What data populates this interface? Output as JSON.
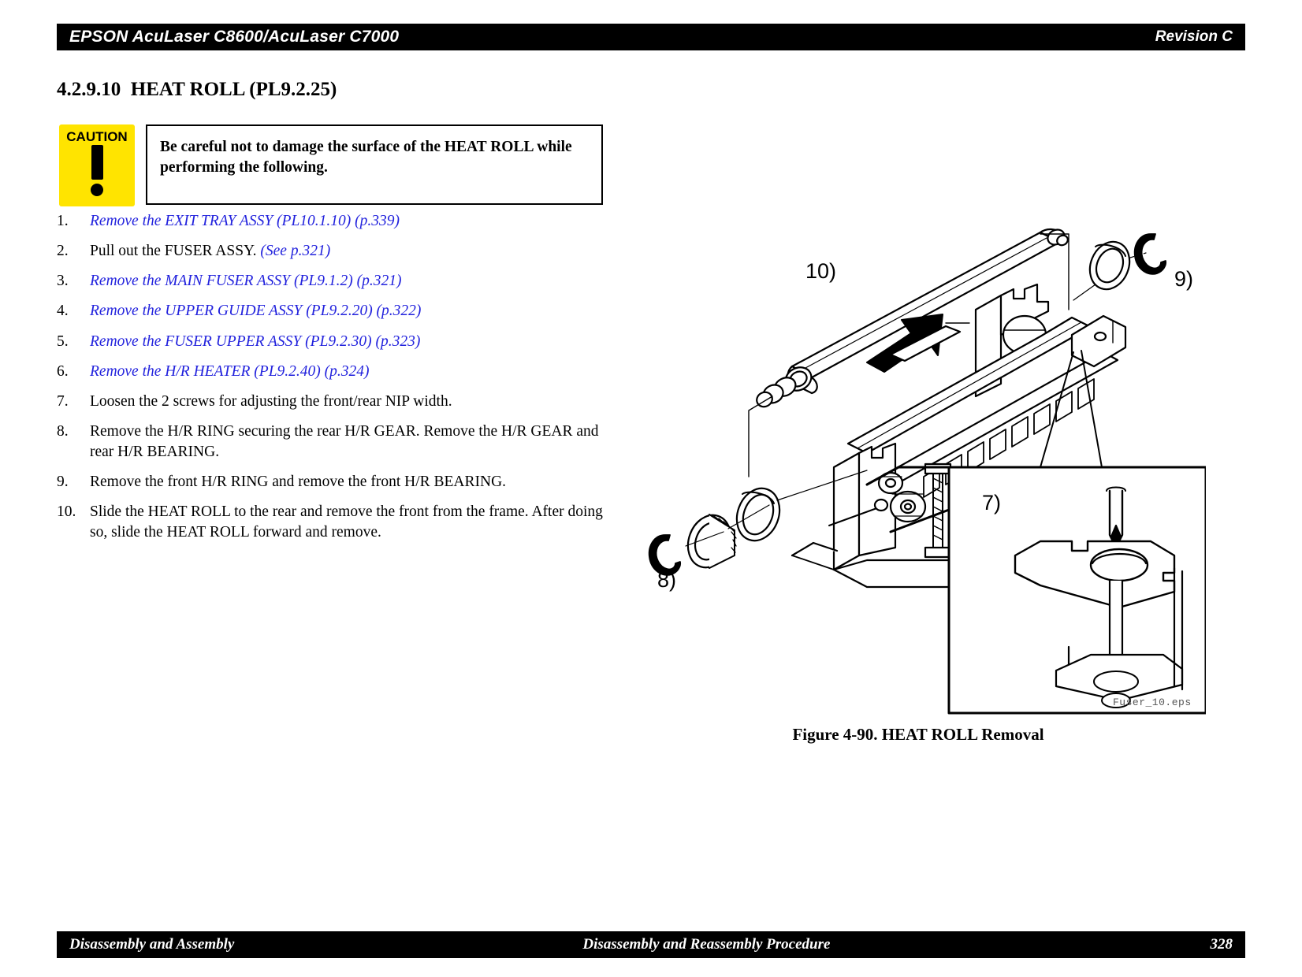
{
  "header": {
    "title": "EPSON AcuLaser C8600/AcuLaser C7000",
    "revision": "Revision C"
  },
  "section": {
    "heading": "4.2.9.10  HEAT ROLL (PL9.2.25)"
  },
  "caution": {
    "badge_label": "CAUTION",
    "text": "Be careful not to damage the surface of the HEAT ROLL while performing the following."
  },
  "steps": [
    {
      "num": "1.",
      "link": "Remove the EXIT TRAY ASSY (PL10.1.10) (p.339)",
      "plain_before": "",
      "plain_after": ""
    },
    {
      "num": "2.",
      "plain_before": "Pull out the FUSER ASSY. ",
      "link": "(See p.321)",
      "plain_after": ""
    },
    {
      "num": "3.",
      "link": "Remove the MAIN FUSER ASSY (PL9.1.2) (p.321)",
      "plain_before": "",
      "plain_after": ""
    },
    {
      "num": "4.",
      "link": "Remove the UPPER GUIDE ASSY (PL9.2.20) (p.322)",
      "plain_before": "",
      "plain_after": ""
    },
    {
      "num": "5.",
      "link": "Remove the FUSER UPPER ASSY (PL9.2.30) (p.323)",
      "plain_before": "",
      "plain_after": ""
    },
    {
      "num": "6.",
      "link": "Remove the H/R HEATER (PL9.2.40) (p.324)",
      "plain_before": "",
      "plain_after": ""
    },
    {
      "num": "7.",
      "plain_before": "Loosen the 2 screws for adjusting the front/rear NIP width.",
      "link": "",
      "plain_after": ""
    },
    {
      "num": "8.",
      "plain_before": "Remove the H/R RING securing the rear H/R GEAR. Remove the H/R GEAR and rear H/R BEARING.",
      "link": "",
      "plain_after": ""
    },
    {
      "num": "9.",
      "plain_before": "Remove the front H/R RING and remove the front H/R BEARING.",
      "link": "",
      "plain_after": ""
    },
    {
      "num": "10.",
      "plain_before": "Slide the HEAT ROLL to the rear and remove the front from the frame. After doing so, slide the HEAT ROLL forward and remove.",
      "link": "",
      "plain_after": ""
    }
  ],
  "figure": {
    "caption": "Figure 4-90.  HEAT ROLL Removal",
    "source_file": "Fuser_10.eps",
    "callouts": {
      "ten": "10)",
      "nine": "9)",
      "eight": "8)",
      "seven": "7)"
    }
  },
  "footer": {
    "left": "Disassembly and Assembly",
    "center": "Disassembly and Reassembly Procedure",
    "page": "328"
  }
}
